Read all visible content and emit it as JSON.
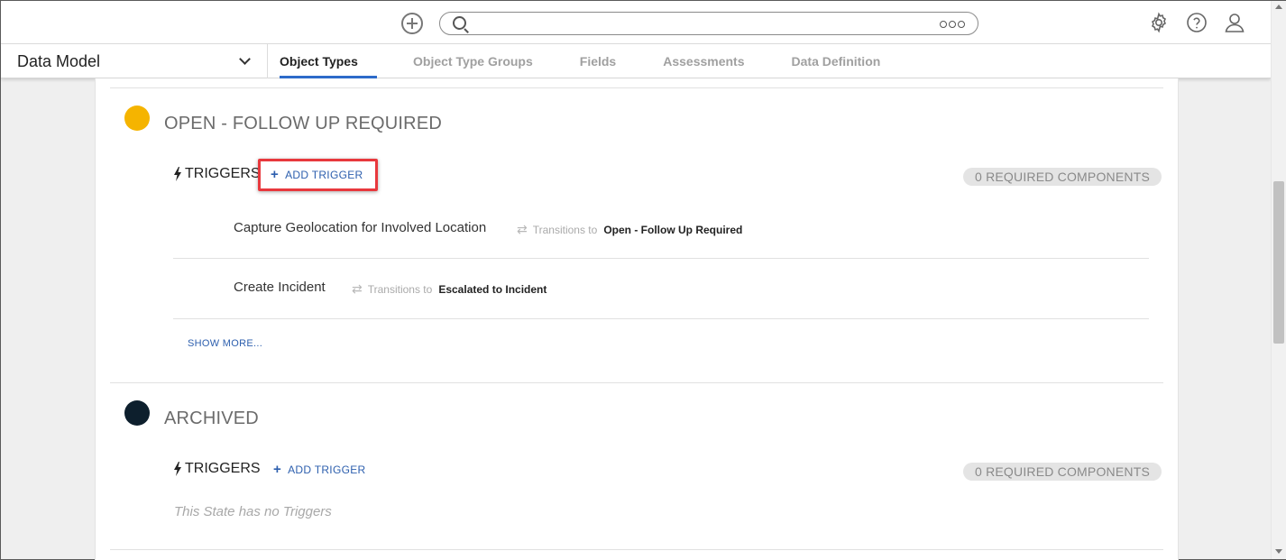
{
  "header": {
    "search_placeholder": "",
    "icons": [
      "add-circle-icon",
      "search-icon",
      "more-icon",
      "gear-icon",
      "help-icon",
      "user-icon"
    ]
  },
  "subnav": {
    "module": "Data Model",
    "tabs": [
      {
        "label": "Object Types",
        "active": true
      },
      {
        "label": "Object Type Groups",
        "active": false
      },
      {
        "label": "Fields",
        "active": false
      },
      {
        "label": "Assessments",
        "active": false
      },
      {
        "label": "Data Definition",
        "active": false
      }
    ]
  },
  "states": [
    {
      "title": "OPEN - FOLLOW UP REQUIRED",
      "color": "#f5b400",
      "triggers_label": "TRIGGERS",
      "add_trigger_label": "ADD TRIGGER",
      "required_components": "0 REQUIRED COMPONENTS",
      "triggers": [
        {
          "name": "Capture Geolocation for Involved Location",
          "transitions_label": "Transitions to",
          "target": "Open - Follow Up Required"
        },
        {
          "name": "Create Incident",
          "transitions_label": "Transitions to",
          "target": "Escalated to Incident"
        }
      ],
      "show_more": "SHOW MORE..."
    },
    {
      "title": "ARCHIVED",
      "color": "#0d1f2d",
      "triggers_label": "TRIGGERS",
      "add_trigger_label": "ADD TRIGGER",
      "required_components": "0 REQUIRED COMPONENTS",
      "empty_text": "This State has no Triggers"
    }
  ],
  "colors": {
    "accent": "#2d6bc9",
    "link": "#2d5fae",
    "highlight": "#e8383d"
  }
}
